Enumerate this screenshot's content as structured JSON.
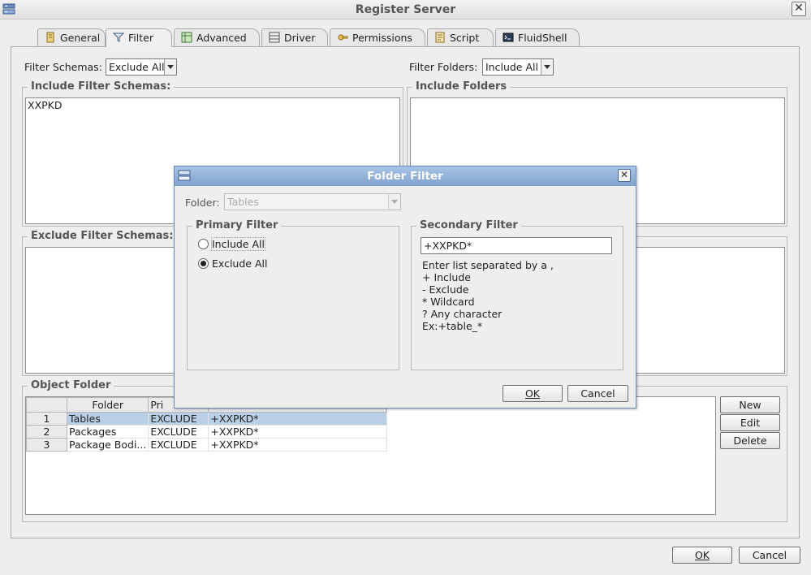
{
  "window": {
    "title": "Register Server"
  },
  "tabs": [
    {
      "label": "General",
      "icon": "general-icon"
    },
    {
      "label": "Filter",
      "icon": "filter-icon",
      "active": true
    },
    {
      "label": "Advanced",
      "icon": "advanced-icon"
    },
    {
      "label": "Driver",
      "icon": "driver-icon"
    },
    {
      "label": "Permissions",
      "icon": "permissions-icon"
    },
    {
      "label": "Script",
      "icon": "script-icon"
    },
    {
      "label": "FluidShell",
      "icon": "fluidshell-icon"
    }
  ],
  "filter": {
    "schemas_label": "Filter Schemas:",
    "schemas_value": "Exclude All",
    "folders_label": "Filter Folders:",
    "folders_value": "Include All",
    "include_schemas_title": "Include Filter Schemas:",
    "include_schemas_text": "XXPKD",
    "include_folders_title": "Include Folders",
    "exclude_schemas_title": "Exclude Filter Schemas:"
  },
  "object_folder": {
    "title": "Object Folder",
    "columns": [
      "",
      "Folder",
      "Pri",
      ""
    ],
    "rows": [
      {
        "num": "1",
        "folder": "Tables",
        "primary": "EXCLUDE",
        "secondary": "+XXPKD*",
        "selected": true
      },
      {
        "num": "2",
        "folder": "Packages",
        "primary": "EXCLUDE",
        "secondary": "+XXPKD*"
      },
      {
        "num": "3",
        "folder": "Package Bodi...",
        "primary": "EXCLUDE",
        "secondary": "+XXPKD*"
      }
    ],
    "new_label": "New",
    "edit_label": "Edit",
    "delete_label": "Delete"
  },
  "footer": {
    "ok_label": "OK",
    "cancel_label": "Cancel"
  },
  "dialog": {
    "title": "Folder Filter",
    "folder_label": "Folder:",
    "folder_value": "Tables",
    "primary_title": "Primary Filter",
    "include_all_label": "Include All",
    "exclude_all_label": "Exclude All",
    "secondary_title": "Secondary Filter",
    "secondary_value": "+XXPKD*",
    "help_lines": [
      "Enter list separated by a ,",
      "+ Include",
      "- Exclude",
      "* Wildcard",
      "? Any character",
      "Ex:+table_*"
    ],
    "ok_label": "OK",
    "cancel_label": "Cancel"
  }
}
